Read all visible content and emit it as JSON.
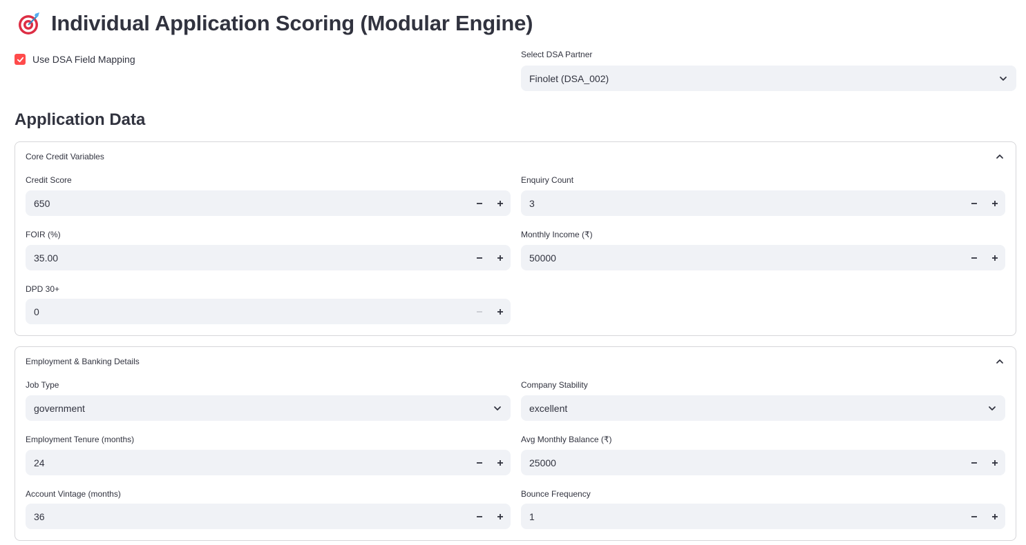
{
  "page": {
    "title": "Individual Application Scoring (Modular Engine)",
    "title_icon": "target-icon"
  },
  "dsa_mapping": {
    "label": "Use DSA Field Mapping",
    "checked": true
  },
  "dsa_partner": {
    "label": "Select DSA Partner",
    "value": "Finolet (DSA_002)"
  },
  "section_title": "Application Data",
  "core": {
    "title": "Core Credit Variables",
    "credit_score": {
      "label": "Credit Score",
      "value": "650"
    },
    "enquiry_count": {
      "label": "Enquiry Count",
      "value": "3"
    },
    "foir": {
      "label": "FOIR (%)",
      "value": "35.00"
    },
    "monthly_income": {
      "label": "Monthly Income (₹)",
      "value": "50000"
    },
    "dpd": {
      "label": "DPD 30+",
      "value": "0"
    }
  },
  "employment": {
    "title": "Employment & Banking Details",
    "job_type": {
      "label": "Job Type",
      "value": "government"
    },
    "company_stability": {
      "label": "Company Stability",
      "value": "excellent"
    },
    "tenure": {
      "label": "Employment Tenure (months)",
      "value": "24"
    },
    "avg_balance": {
      "label": "Avg Monthly Balance (₹)",
      "value": "25000"
    },
    "vintage": {
      "label": "Account Vintage (months)",
      "value": "36"
    },
    "bounce": {
      "label": "Bounce Frequency",
      "value": "1"
    }
  },
  "colors": {
    "accent": "#ff4b4b",
    "input_bg": "#f0f2f6",
    "border": "#d6d6d9",
    "text": "#31333f"
  }
}
